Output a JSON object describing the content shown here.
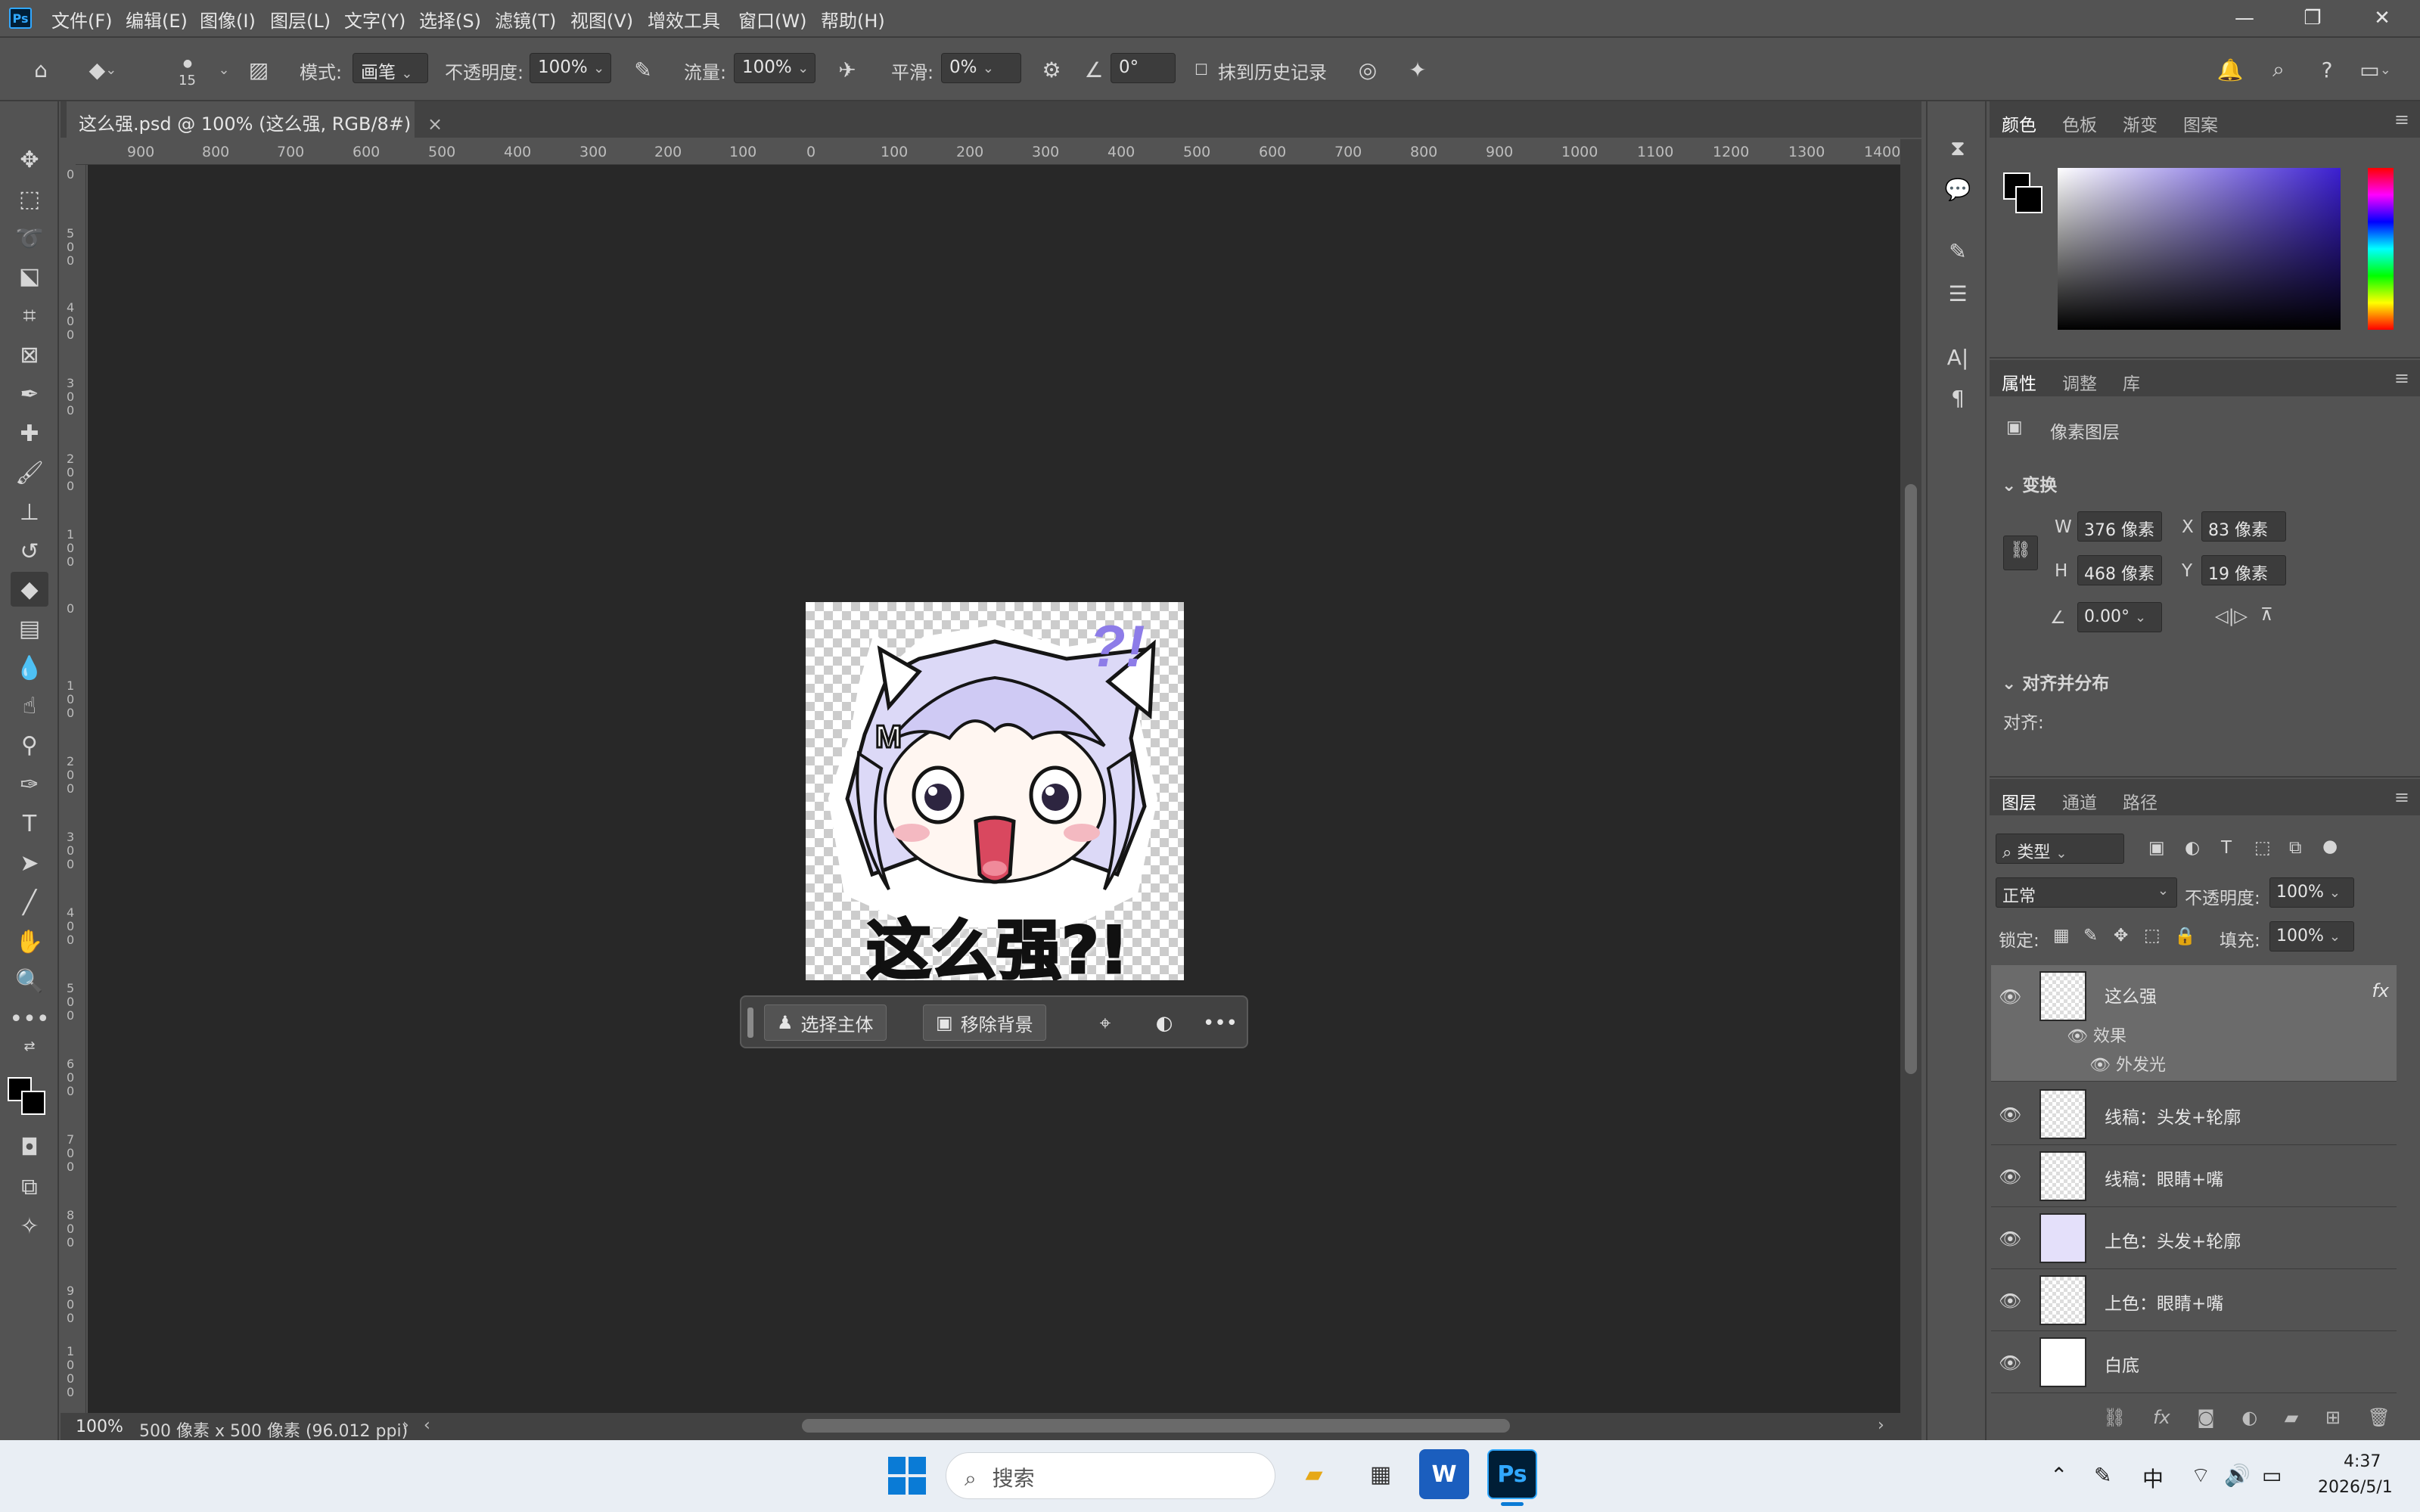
{
  "app": {
    "logo": "Ps",
    "menu": [
      "文件(F)",
      "编辑(E)",
      "图像(I)",
      "图层(L)",
      "文字(Y)",
      "选择(S)",
      "滤镜(T)",
      "视图(V)",
      "增效工具",
      "窗口(W)",
      "帮助(H)"
    ],
    "window_controls": [
      "minimize",
      "restore",
      "close"
    ]
  },
  "options": {
    "brush_size": "15",
    "mode_label": "模式:",
    "mode_value": "画笔",
    "opacity_label": "不透明度:",
    "opacity_value": "100%",
    "flow_label": "流量:",
    "flow_value": "100%",
    "smooth_label": "平滑:",
    "smooth_value": "0%",
    "angle_value": "0°",
    "history_label": "抹到历史记录"
  },
  "document": {
    "tab_title": "这么强.psd @ 100% (这么强, RGB/8#)",
    "ruler_h": [
      "900",
      "800",
      "700",
      "600",
      "500",
      "400",
      "300",
      "200",
      "100",
      "0",
      "100",
      "200",
      "300",
      "400",
      "500",
      "600",
      "700",
      "800",
      "900",
      "1000",
      "1100",
      "1200",
      "1300",
      "1400"
    ],
    "ruler_v": [
      "0",
      "5 0 0",
      "4 0 0",
      "3 0 0",
      "2 0 0",
      "1 0 0",
      "0",
      "1 0 0",
      "2 0 0",
      "3 0 0",
      "4 0 0",
      "5 0 0",
      "6 0 0",
      "7 0 0",
      "8 0 0",
      "9 0 0",
      "1 0 0 0"
    ],
    "sticker_text": "这么强?!",
    "sticker_marks": "?!",
    "zoom": "100%",
    "status": "500 像素 x 500 像素 (96.012 ppi)"
  },
  "context_bar": {
    "select_subject": "选择主体",
    "remove_bg": "移除背景"
  },
  "color_panel": {
    "tabs": [
      "颜色",
      "色板",
      "渐变",
      "图案"
    ],
    "fg_color": "#000000",
    "bg_color": "#000000"
  },
  "properties": {
    "tabs": [
      "属性",
      "调整",
      "库"
    ],
    "type": "像素图层",
    "transform_title": "变换",
    "w_label": "W",
    "w_value": "376 像素",
    "x_label": "X",
    "x_value": "83 像素",
    "h_label": "H",
    "h_value": "468 像素",
    "y_label": "Y",
    "y_value": "19 像素",
    "angle_value": "0.00°",
    "align_title": "对齐并分布",
    "align_label": "对齐:"
  },
  "layers_panel": {
    "tabs": [
      "图层",
      "通道",
      "路径"
    ],
    "filter_label": "类型",
    "blend_mode": "正常",
    "opacity_label": "不透明度:",
    "opacity_value": "100%",
    "lock_label": "锁定:",
    "fill_label": "填充:",
    "fill_value": "100%",
    "layers": [
      {
        "name": "这么强",
        "fx": "fx",
        "effects_label": "效果",
        "effect": "外发光",
        "selected": true
      },
      {
        "name": "线稿：头发+轮廓"
      },
      {
        "name": "线稿：眼睛+嘴"
      },
      {
        "name": "上色：头发+轮廓"
      },
      {
        "name": "上色：眼睛+嘴"
      },
      {
        "name": "白底"
      }
    ]
  },
  "taskbar": {
    "search_placeholder": "搜索",
    "ime": "中",
    "time": "4:37",
    "date": "2026/5/1"
  }
}
